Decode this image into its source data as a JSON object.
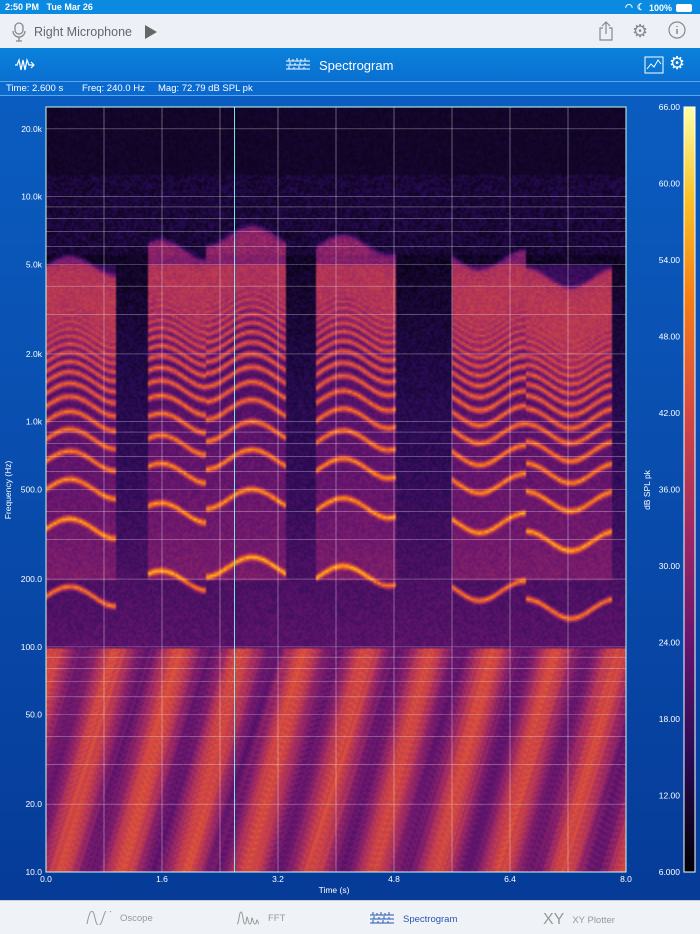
{
  "status": {
    "time": "2:50 PM",
    "date": "Tue Mar 26",
    "battery": "100%"
  },
  "topbar": {
    "source": "Right Microphone"
  },
  "navbar": {
    "title": "Spectrogram"
  },
  "readout": {
    "time": "Time: 2.600 s",
    "freq": "Freq: 240.0 Hz",
    "mag": "Mag: 72.79 dB SPL pk"
  },
  "chart_data": {
    "type": "heatmap",
    "xlabel": "Time (s)",
    "ylabel": "Frequency (Hz)",
    "colorbar_label": "dB SPL pk",
    "xlim": [
      0,
      8
    ],
    "x_ticks": [
      "0.0",
      "1.6",
      "3.2",
      "4.8",
      "6.4",
      "8.0"
    ],
    "ylim": [
      10,
      25000
    ],
    "y_scale": "log",
    "y_ticks": [
      {
        "v": 10,
        "l": "10.0"
      },
      {
        "v": 20,
        "l": "20.0"
      },
      {
        "v": 50,
        "l": "50.0"
      },
      {
        "v": 100,
        "l": "100.0"
      },
      {
        "v": 200,
        "l": "200.0"
      },
      {
        "v": 500,
        "l": "500.0"
      },
      {
        "v": 1000,
        "l": "1.0k"
      },
      {
        "v": 2000,
        "l": "2.0k"
      },
      {
        "v": 5000,
        "l": "5.0k"
      },
      {
        "v": 10000,
        "l": "10.0k"
      },
      {
        "v": 20000,
        "l": "20.0k"
      }
    ],
    "clim": [
      6,
      66
    ],
    "c_ticks": [
      "6.000",
      "12.00",
      "18.00",
      "24.00",
      "30.00",
      "36.00",
      "42.00",
      "48.00",
      "54.00",
      "60.00",
      "66.00"
    ],
    "cursor": {
      "time": 2.6,
      "freq": 240.0
    }
  },
  "tabs": [
    {
      "label": "Oscope",
      "icon": "oscope-icon"
    },
    {
      "label": "FFT",
      "icon": "fft-icon"
    },
    {
      "label": "Spectrogram",
      "icon": "spectrogram-icon",
      "active": true
    },
    {
      "label": "XY Plotter",
      "icon": "xy-icon",
      "glyph": "XY"
    }
  ],
  "colors": {
    "accent": "#0a82dc",
    "active_tab": "#2a56b0"
  }
}
